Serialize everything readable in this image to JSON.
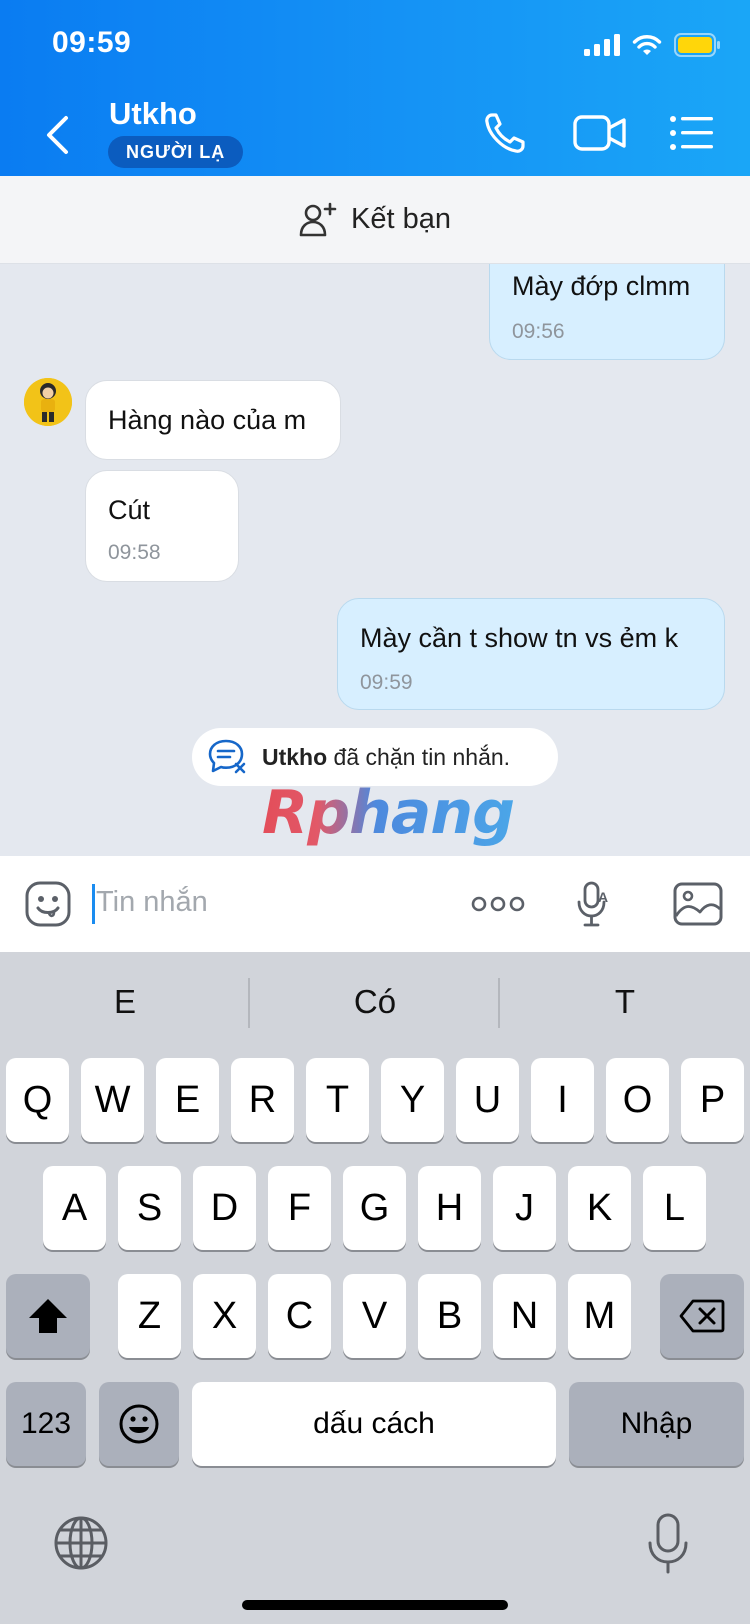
{
  "status_bar": {
    "time": "09:59"
  },
  "header": {
    "contact_name": "Utkho",
    "badge": "NGƯỜI LẠ",
    "icons": [
      "back-icon",
      "phone-icon",
      "video-call-icon",
      "menu-list-icon"
    ]
  },
  "add_friend": {
    "label": "Kết bạn"
  },
  "messages": [
    {
      "side": "out",
      "text": "Mày đớp clmm",
      "time": "09:56"
    },
    {
      "side": "in",
      "text": "Hàng nào của m",
      "time": ""
    },
    {
      "side": "in",
      "text": "Cút",
      "time": "09:58"
    },
    {
      "side": "out",
      "text": "Mày cần t show tn vs ẻm k",
      "time": "09:59"
    }
  ],
  "blocked_notice": {
    "name": "Utkho",
    "text": " đã chặn tin nhắn."
  },
  "watermark": "Rphang",
  "composer": {
    "placeholder": "Tin nhắn"
  },
  "keyboard": {
    "suggestions": [
      "E",
      "Có",
      "T"
    ],
    "row1": [
      "Q",
      "W",
      "E",
      "R",
      "T",
      "Y",
      "U",
      "I",
      "O",
      "P"
    ],
    "row2": [
      "A",
      "S",
      "D",
      "F",
      "G",
      "H",
      "J",
      "K",
      "L"
    ],
    "row3": [
      "Z",
      "X",
      "C",
      "V",
      "B",
      "N",
      "M"
    ],
    "numbers_key": "123",
    "space_key": "dấu cách",
    "return_key": "Nhập"
  },
  "colors": {
    "header_blue": "#0a7cf2",
    "outgoing_bubble": "#d7efff",
    "chat_bg": "#e4e8ef"
  }
}
